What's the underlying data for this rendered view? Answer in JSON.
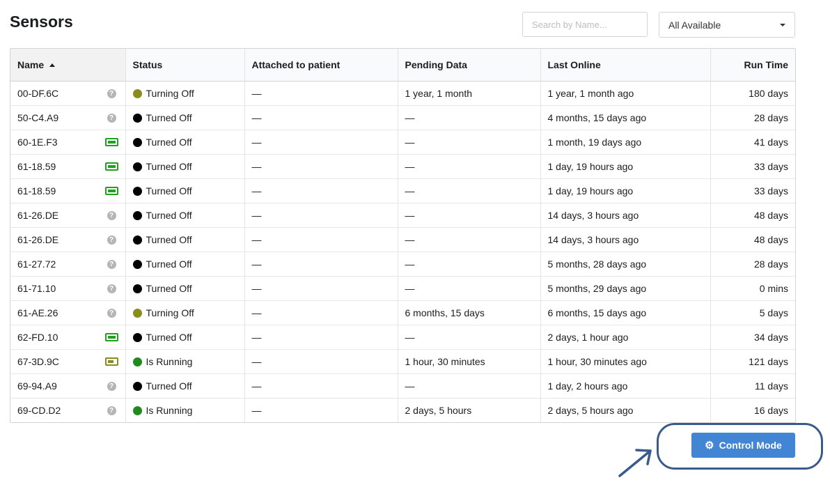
{
  "page": {
    "title": "Sensors"
  },
  "search": {
    "placeholder": "Search by Name..."
  },
  "filter": {
    "selected": "All Available"
  },
  "table": {
    "headers": {
      "name": "Name",
      "status": "Status",
      "attached": "Attached to patient",
      "pending": "Pending Data",
      "last_online": "Last Online",
      "run_time": "Run Time"
    },
    "rows": [
      {
        "name": "00-DF.6C",
        "icon": "question-icon",
        "status": "Turning Off",
        "status_color": "#8b8b1e",
        "attached": "—",
        "pending": "1 year, 1 month",
        "last_online": "1 year, 1 month ago",
        "run_time": "180 days"
      },
      {
        "name": "50-C4.A9",
        "icon": "question-icon",
        "status": "Turned Off",
        "status_color": "#000000",
        "attached": "—",
        "pending": "—",
        "last_online": "4 months, 15 days ago",
        "run_time": "28 days"
      },
      {
        "name": "60-1E.F3",
        "icon": "battery-full-icon",
        "status": "Turned Off",
        "status_color": "#000000",
        "attached": "—",
        "pending": "—",
        "last_online": "1 month, 19 days ago",
        "run_time": "41 days"
      },
      {
        "name": "61-18.59",
        "icon": "battery-full-icon",
        "status": "Turned Off",
        "status_color": "#000000",
        "attached": "—",
        "pending": "—",
        "last_online": "1 day, 19 hours ago",
        "run_time": "33 days"
      },
      {
        "name": "61-18.59",
        "icon": "battery-full-icon",
        "status": "Turned Off",
        "status_color": "#000000",
        "attached": "—",
        "pending": "—",
        "last_online": "1 day, 19 hours ago",
        "run_time": "33 days"
      },
      {
        "name": "61-26.DE",
        "icon": "question-icon",
        "status": "Turned Off",
        "status_color": "#000000",
        "attached": "—",
        "pending": "—",
        "last_online": "14 days, 3 hours ago",
        "run_time": "48 days"
      },
      {
        "name": "61-26.DE",
        "icon": "question-icon",
        "status": "Turned Off",
        "status_color": "#000000",
        "attached": "—",
        "pending": "—",
        "last_online": "14 days, 3 hours ago",
        "run_time": "48 days"
      },
      {
        "name": "61-27.72",
        "icon": "question-icon",
        "status": "Turned Off",
        "status_color": "#000000",
        "attached": "—",
        "pending": "—",
        "last_online": "5 months, 28 days ago",
        "run_time": "28 days"
      },
      {
        "name": "61-71.10",
        "icon": "question-icon",
        "status": "Turned Off",
        "status_color": "#000000",
        "attached": "—",
        "pending": "—",
        "last_online": "5 months, 29 days ago",
        "run_time": "0 mins"
      },
      {
        "name": "61-AE.26",
        "icon": "question-icon",
        "status": "Turning Off",
        "status_color": "#8b8b1e",
        "attached": "—",
        "pending": "6 months, 15 days",
        "last_online": "6 months, 15 days ago",
        "run_time": "5 days"
      },
      {
        "name": "62-FD.10",
        "icon": "battery-full-icon",
        "status": "Turned Off",
        "status_color": "#000000",
        "attached": "—",
        "pending": "—",
        "last_online": "2 days, 1 hour ago",
        "run_time": "34 days"
      },
      {
        "name": "67-3D.9C",
        "icon": "battery-medium-icon",
        "status": "Is Running",
        "status_color": "#1e8b1e",
        "attached": "—",
        "pending": "1 hour, 30 minutes",
        "last_online": "1 hour, 30 minutes ago",
        "run_time": "121 days"
      },
      {
        "name": "69-94.A9",
        "icon": "question-icon",
        "status": "Turned Off",
        "status_color": "#000000",
        "attached": "—",
        "pending": "—",
        "last_online": "1 day, 2 hours ago",
        "run_time": "11 days"
      },
      {
        "name": "69-CD.D2",
        "icon": "question-icon",
        "status": "Is Running",
        "status_color": "#1e8b1e",
        "attached": "—",
        "pending": "2 days, 5 hours",
        "last_online": "2 days, 5 hours ago",
        "run_time": "16 days"
      }
    ]
  },
  "actions": {
    "control_mode_label": "Control Mode"
  },
  "colors": {
    "primary_button": "#4285d4",
    "annotation": "#3a5a8c"
  }
}
